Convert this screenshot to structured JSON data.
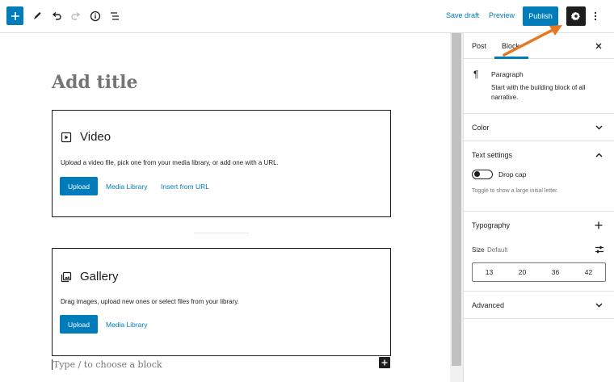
{
  "toolbar": {
    "save_draft": "Save draft",
    "preview": "Preview",
    "publish": "Publish"
  },
  "editor": {
    "title_placeholder": "Add title",
    "video_block": {
      "label": "Video",
      "description": "Upload a video file, pick one from your media library, or add one with a URL.",
      "upload": "Upload",
      "media_library": "Media Library",
      "insert_url": "Insert from URL"
    },
    "gallery_block": {
      "label": "Gallery",
      "description": "Drag images, upload new ones or select files from your library.",
      "upload": "Upload",
      "media_library": "Media Library"
    },
    "appender_placeholder": "Type / to choose a block"
  },
  "sidebar": {
    "tabs": [
      {
        "label": "Post"
      },
      {
        "label": "Block"
      }
    ],
    "active_tab": "Block",
    "block_card": {
      "icon": "paragraph-icon",
      "title": "Paragraph",
      "description": "Start with the building block of all narrative."
    },
    "panels": {
      "color": "Color",
      "text_settings": "Text settings",
      "drop_cap": "Drop cap",
      "drop_cap_help": "Toggle to show a large initial letter.",
      "typography": "Typography",
      "size_label": "Size",
      "size_value": "Default",
      "sizes": [
        "13",
        "20",
        "36",
        "42"
      ],
      "advanced": "Advanced"
    }
  },
  "colors": {
    "accent": "#007cba",
    "dark": "#1e1e1e",
    "annotation": "#e87722"
  }
}
